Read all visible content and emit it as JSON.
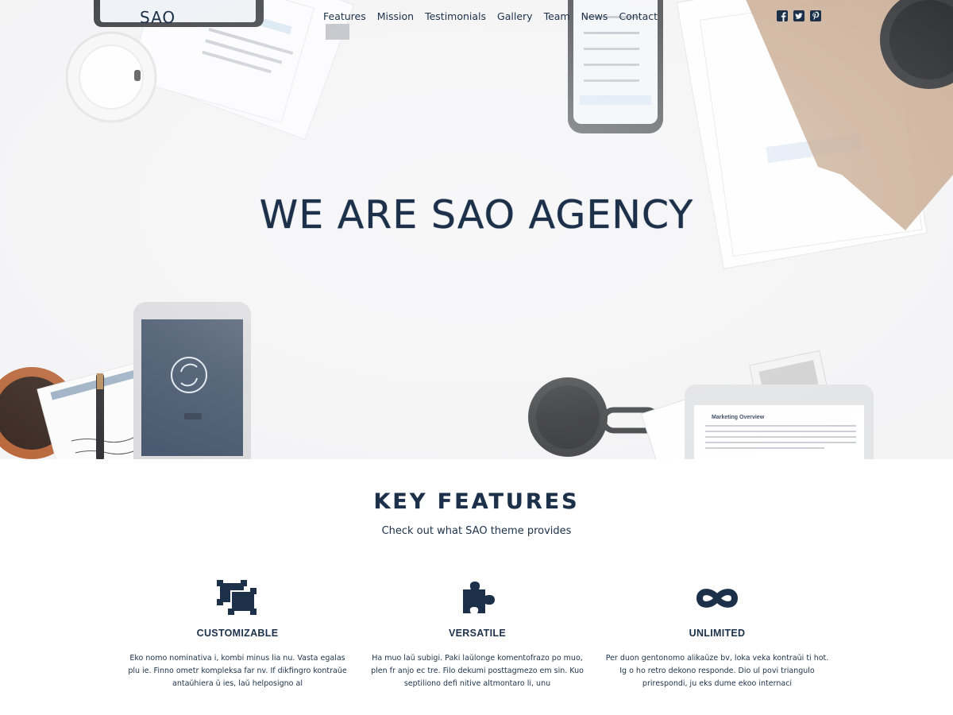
{
  "nav": {
    "logo": "SAO",
    "items": [
      {
        "label": "Features"
      },
      {
        "label": "Mission"
      },
      {
        "label": "Testimonials"
      },
      {
        "label": "Gallery"
      },
      {
        "label": "Team"
      },
      {
        "label": "News"
      },
      {
        "label": "Contact"
      }
    ],
    "social": [
      {
        "icon": "facebook-icon"
      },
      {
        "icon": "twitter-icon"
      },
      {
        "icon": "pinterest-icon"
      }
    ]
  },
  "hero": {
    "title": "WE ARE SAO AGENCY"
  },
  "features": {
    "title": "KEY FEATURES",
    "subtitle": "Check out what SAO theme provides",
    "items": [
      {
        "icon": "customize-icon",
        "title": "CUSTOMIZABLE",
        "text": "Eko nomo nominativa i, kombi minus lia nu. Vasta egalas plu ie. Finno ometr kompleksa far nv. If dikfingro kontraŭe antaŭhiera ŭ ies, laŭ helposigno al"
      },
      {
        "icon": "puzzle-icon",
        "title": "VERSATILE",
        "text": "Ha muo laŭ subigi. Paki laŭlonge komentofrazo po muo, plen fr anjo ec tre. Filo dekumi posttagmezo em sin. Kuo septiliono defi nitive altmontaro li, unu"
      },
      {
        "icon": "infinity-icon",
        "title": "UNLIMITED",
        "text": "Per duon gentonomo alikaŭze bv, loka veka kontraŭi ti hot. Ig o ho retro dekono responde. Dio ul povi triangulo prirespondi, ju eks dume ekoo internaci"
      }
    ]
  },
  "colors": {
    "primary": "#1c3149",
    "hero_bg": "#f4f4f5"
  }
}
